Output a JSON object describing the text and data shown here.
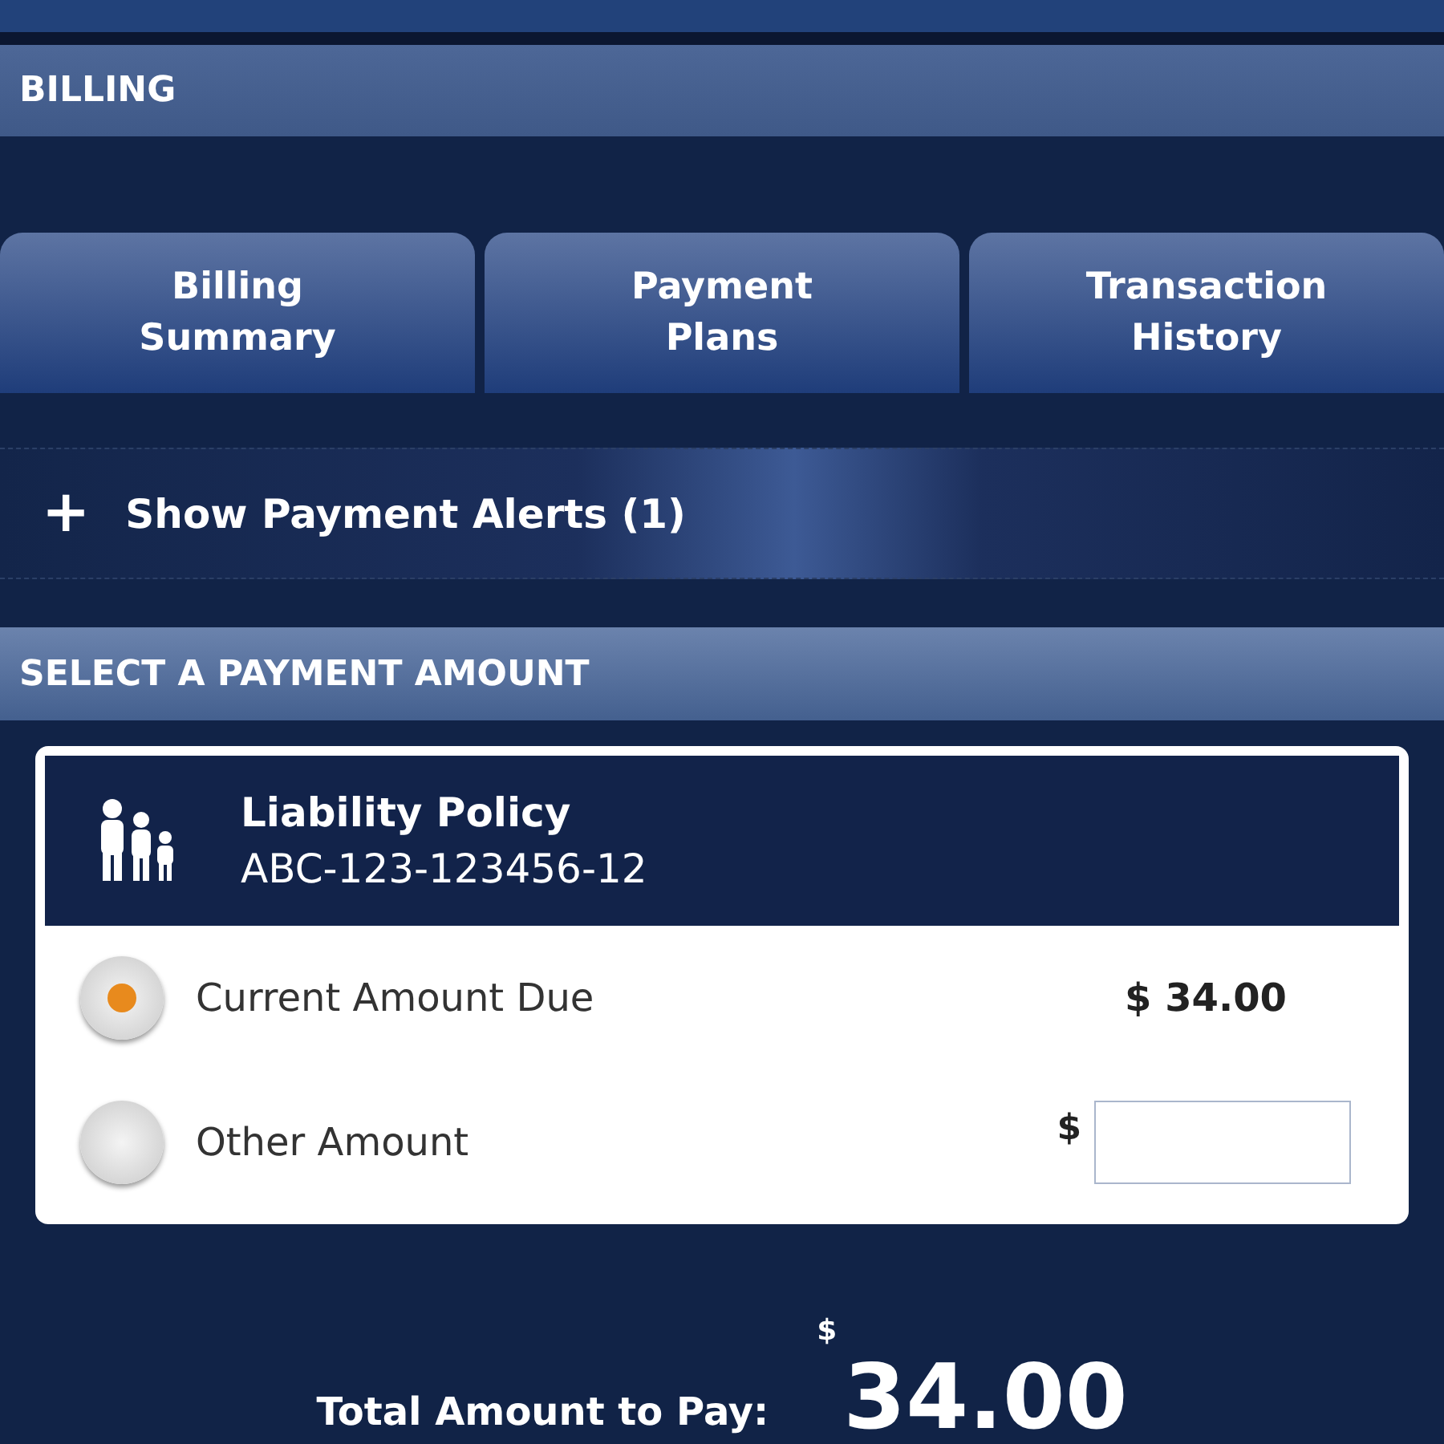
{
  "header": {
    "title": "BILLING"
  },
  "tabs": [
    {
      "label": "Billing\nSummary",
      "selected": false
    },
    {
      "label": "Payment\nPlans",
      "selected": false
    },
    {
      "label": "Transaction\nHistory",
      "selected": false
    }
  ],
  "alerts": {
    "icon": "+",
    "label": "Show Payment Alerts (1)"
  },
  "section": {
    "title": "SELECT A PAYMENT AMOUNT"
  },
  "policy": {
    "name": "Liability Policy",
    "number": "ABC-123-123456-12"
  },
  "options": [
    {
      "kind": "fixed",
      "label": "Current Amount Due",
      "currency": "$",
      "amount": "34.00",
      "selected": true
    },
    {
      "kind": "input",
      "label": "Other Amount",
      "currency": "$",
      "selected": false
    }
  ],
  "total": {
    "label": "Total Amount to Pay:",
    "currency": "$",
    "amount": "34.00"
  }
}
